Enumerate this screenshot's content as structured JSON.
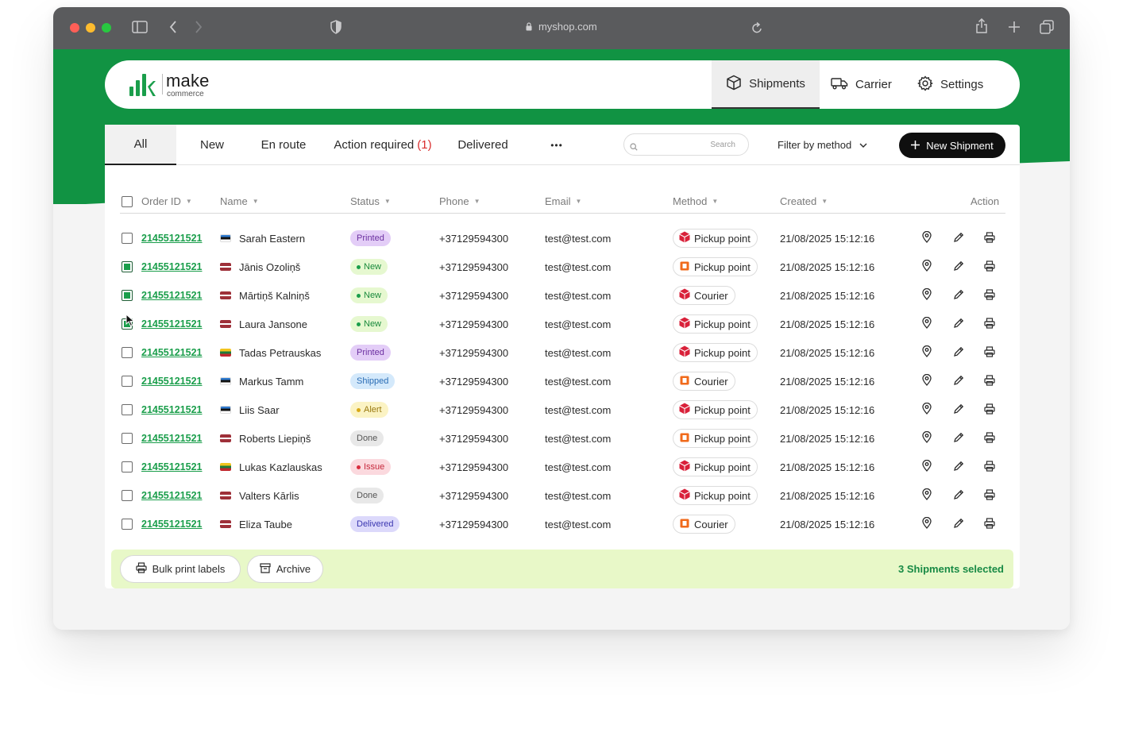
{
  "browser": {
    "url": "myshop.com"
  },
  "brand": {
    "name": "make",
    "subname": "commerce",
    "color": "#119343"
  },
  "nav": [
    {
      "label": "Shipments",
      "icon": "box-icon",
      "active": true
    },
    {
      "label": "Carrier",
      "icon": "truck-icon",
      "active": false
    },
    {
      "label": "Settings",
      "icon": "gear-icon",
      "active": false
    }
  ],
  "tabs": {
    "all": "All",
    "new": "New",
    "en_route": "En route",
    "action_required": "Action required",
    "action_required_count": "(1)",
    "delivered": "Delivered",
    "more": "•••"
  },
  "search": {
    "placeholder": "Search"
  },
  "filter": {
    "label": "Filter by method"
  },
  "new_shipment": {
    "label": "New Shipment"
  },
  "columns": {
    "order_id": "Order ID",
    "name": "Name",
    "status": "Status",
    "phone": "Phone",
    "email": "Email",
    "method": "Method",
    "created": "Created",
    "action": "Action"
  },
  "status_styles": {
    "Printed": {
      "bg": "#e3cdf7",
      "fg": "#6b2fa0",
      "dot": ""
    },
    "New": {
      "bg": "#e6f8d0",
      "fg": "#1a8a3c",
      "dot": "#1a9e4b"
    },
    "Shipped": {
      "bg": "#d4e9fb",
      "fg": "#2a6db5",
      "dot": ""
    },
    "Alert": {
      "bg": "#fbf3c4",
      "fg": "#9a7a10",
      "dot": "#d8a917"
    },
    "Done": {
      "bg": "#e8e8e8",
      "fg": "#555555",
      "dot": ""
    },
    "Issue": {
      "bg": "#fbd9de",
      "fg": "#c6283b",
      "dot": "#d92d3f"
    },
    "Delivered": {
      "bg": "#dcd9fb",
      "fg": "#3a36b0",
      "dot": ""
    }
  },
  "carrier_colors": {
    "red": "#d9213a",
    "orange": "#f06a1b"
  },
  "rows": [
    {
      "checked": false,
      "order_id": "21455121521",
      "flag": "ee",
      "name": "Sarah Eastern",
      "status": "Printed",
      "phone": "+37129594300",
      "email": "test@test.com",
      "carrier": "red",
      "method": "Pickup point",
      "created": "21/08/2025 15:12:16"
    },
    {
      "checked": true,
      "order_id": "21455121521",
      "flag": "lv",
      "name": "Jānis Ozoliņš",
      "status": "New",
      "phone": "+37129594300",
      "email": "test@test.com",
      "carrier": "orange",
      "method": "Pickup point",
      "created": "21/08/2025 15:12:16"
    },
    {
      "checked": true,
      "order_id": "21455121521",
      "flag": "lv",
      "name": "Mārtiņš Kalniņš",
      "status": "New",
      "phone": "+37129594300",
      "email": "test@test.com",
      "carrier": "red",
      "method": "Courier",
      "created": "21/08/2025 15:12:16"
    },
    {
      "checked": true,
      "order_id": "21455121521",
      "flag": "lv",
      "name": "Laura Jansone",
      "status": "New",
      "phone": "+37129594300",
      "email": "test@test.com",
      "carrier": "red",
      "method": "Pickup point",
      "created": "21/08/2025 15:12:16"
    },
    {
      "checked": false,
      "order_id": "21455121521",
      "flag": "lt",
      "name": "Tadas Petrauskas",
      "status": "Printed",
      "phone": "+37129594300",
      "email": "test@test.com",
      "carrier": "red",
      "method": "Pickup point",
      "created": "21/08/2025 15:12:16"
    },
    {
      "checked": false,
      "order_id": "21455121521",
      "flag": "ee",
      "name": "Markus Tamm",
      "status": "Shipped",
      "phone": "+37129594300",
      "email": "test@test.com",
      "carrier": "orange",
      "method": "Courier",
      "created": "21/08/2025 15:12:16"
    },
    {
      "checked": false,
      "order_id": "21455121521",
      "flag": "ee",
      "name": "Liis Saar",
      "status": "Alert",
      "phone": "+37129594300",
      "email": "test@test.com",
      "carrier": "red",
      "method": "Pickup point",
      "created": "21/08/2025 15:12:16"
    },
    {
      "checked": false,
      "order_id": "21455121521",
      "flag": "lv",
      "name": "Roberts Liepiņš",
      "status": "Done",
      "phone": "+37129594300",
      "email": "test@test.com",
      "carrier": "orange",
      "method": "Pickup point",
      "created": "21/08/2025 15:12:16"
    },
    {
      "checked": false,
      "order_id": "21455121521",
      "flag": "lt",
      "name": "Lukas Kazlauskas",
      "status": "Issue",
      "phone": "+37129594300",
      "email": "test@test.com",
      "carrier": "red",
      "method": "Pickup point",
      "created": "21/08/2025 15:12:16"
    },
    {
      "checked": false,
      "order_id": "21455121521",
      "flag": "lv",
      "name": "Valters Kārlis",
      "status": "Done",
      "phone": "+37129594300",
      "email": "test@test.com",
      "carrier": "red",
      "method": "Pickup point",
      "created": "21/08/2025 15:12:16"
    },
    {
      "checked": false,
      "order_id": "21455121521",
      "flag": "lv",
      "name": "Eliza Taube",
      "status": "Delivered",
      "phone": "+37129594300",
      "email": "test@test.com",
      "carrier": "orange",
      "method": "Courier",
      "created": "21/08/2025 15:12:16"
    }
  ],
  "footer": {
    "bulk_print": "Bulk print labels",
    "archive": "Archive",
    "selected": "3 Shipments selected"
  }
}
